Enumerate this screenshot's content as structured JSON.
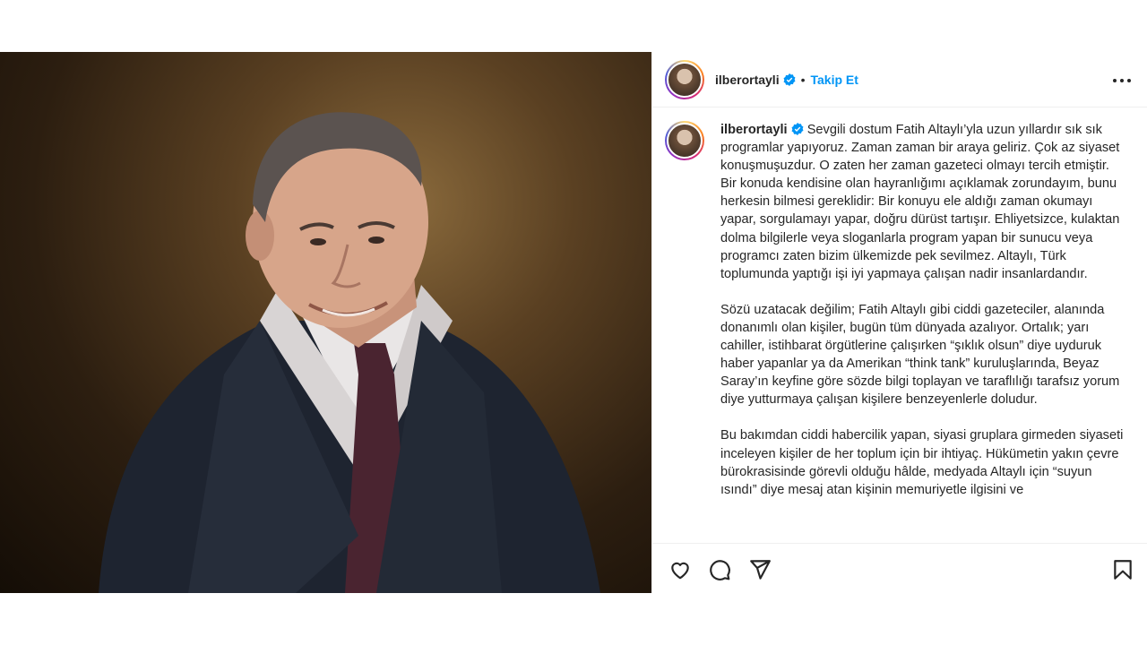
{
  "post": {
    "username": "ilberortayli",
    "separator": "•",
    "follow_label": "Takip Et",
    "photo_icon": "portrait-photo",
    "colors": {
      "follow": "#0095f6",
      "verified": "#0095f6",
      "border": "#efefef",
      "text": "#262626"
    }
  },
  "caption": {
    "username": "ilberortayli",
    "paragraph_1": "Sevgili dostum Fatih Altaylı’yla uzun yıllardır sık sık programlar yapıyoruz. Zaman zaman bir araya geliriz. Çok az siyaset konuşmuşuzdur. O zaten her zaman gazeteci olmayı tercih etmiştir. Bir konuda kendisine olan hayranlığımı açıklamak zorundayım, bunu herkesin bilmesi gereklidir: Bir konuyu ele aldığı zaman okumayı yapar, sorgulamayı yapar, doğru dürüst tartışır. Ehliyetsizce, kulaktan dolma bilgilerle veya sloganlarla program yapan bir sunucu veya programcı zaten bizim ülkemizde pek sevilmez. Altaylı, Türk toplumunda yaptığı işi iyi yapmaya çalışan nadir insanlardandır.",
    "paragraph_2": "Sözü uzatacak değilim; Fatih Altaylı gibi ciddi gazeteciler, alanında donanımlı olan kişiler, bugün tüm dünyada azalıyor. Ortalık; yarı cahiller, istihbarat örgütlerine çalışırken “şıklık olsun” diye uyduruk haber yapanlar ya da Amerikan “think tank” kuruluşlarında, Beyaz Saray’ın keyfine göre sözde bilgi toplayan ve taraflılığı tarafsız yorum diye yutturmaya çalışan kişilere benzeyenlerle doludur.",
    "paragraph_3": "Bu bakımdan ciddi habercilik yapan, siyasi gruplara girmeden siyaseti inceleyen kişiler de her toplum için bir ihtiyaç. Hükümetin yakın çevre bürokrasisinde görevli olduğu hâlde, medyada Altaylı için “suyun ısındı” diye mesaj atan kişinin memuriyetle ilgisini ve"
  },
  "actions": {
    "icons": [
      "heart-icon",
      "comment-icon",
      "share-icon",
      "bookmark-icon"
    ]
  }
}
